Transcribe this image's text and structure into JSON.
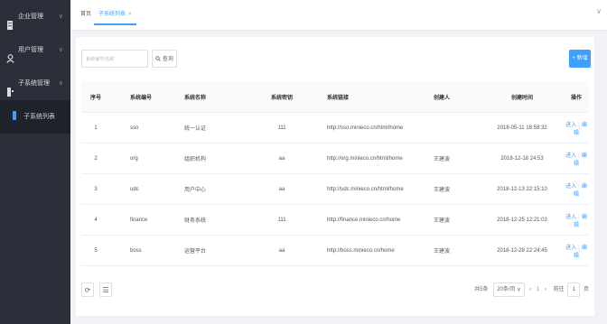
{
  "sidebar": {
    "items": [
      {
        "label": "企业管理",
        "icon": "building-icon",
        "expand": "∨"
      },
      {
        "label": "用户管理",
        "icon": "user-icon",
        "expand": "∨"
      },
      {
        "label": "子系统管理",
        "icon": "grid-icon",
        "expand": "∧"
      }
    ],
    "sub_items": [
      {
        "label": "子系统列表",
        "icon": "list-icon"
      }
    ]
  },
  "header": {
    "tabs": [
      {
        "label": "首页"
      },
      {
        "label": "子系统列表",
        "close": "×"
      }
    ],
    "dropdown": "∨"
  },
  "toolbar": {
    "search_placeholder": "系统编号/名称",
    "query_icon": "search-icon",
    "query_label": "查询",
    "add_label": "+ 新增"
  },
  "table": {
    "columns": [
      "序号",
      "系统编号",
      "系统名称",
      "系统密钥",
      "系统链接",
      "创建人",
      "创建时间",
      "操作"
    ],
    "rows": [
      {
        "no": "1",
        "code": "sso",
        "name": "统一认证",
        "key": "111",
        "link": "http://sso.minieco.cn/html/home",
        "creator": "",
        "created": "2018-05-11 18:58:32"
      },
      {
        "no": "2",
        "code": "org",
        "name": "组织机构",
        "key": "aa",
        "link": "http://org.minieco.cn/html/home",
        "creator": "王建波",
        "created": "2018-12-18 24:53"
      },
      {
        "no": "3",
        "code": "udc",
        "name": "用户中心",
        "key": "aa",
        "link": "http://udc.minieco.cn/html/home",
        "creator": "王建波",
        "created": "2018-12-13 22:15:10"
      },
      {
        "no": "4",
        "code": "finance",
        "name": "财务系统",
        "key": "111",
        "link": "http://finance.minieco.cn/home",
        "creator": "王建波",
        "created": "2018-12-25 12:21:03"
      },
      {
        "no": "5",
        "code": "boss",
        "name": "运营平台",
        "key": "aa",
        "link": "http://boss.minieco.cn/home",
        "creator": "王建波",
        "created": "2018-12-28 22:24:45"
      }
    ],
    "ops": {
      "enter": "进入",
      "edit": "编辑",
      "sep": "|"
    }
  },
  "footer": {
    "refresh_icon": "refresh-icon",
    "columns_icon": "columns-icon",
    "total": "共5条",
    "page_size": "20条/页",
    "prev": "‹",
    "page": "1",
    "next": "›",
    "goto": "前往",
    "goto_page": "1",
    "page_unit": "页"
  },
  "colors": {
    "accent": "#409eff",
    "sidebar": "#2b2f3a"
  }
}
